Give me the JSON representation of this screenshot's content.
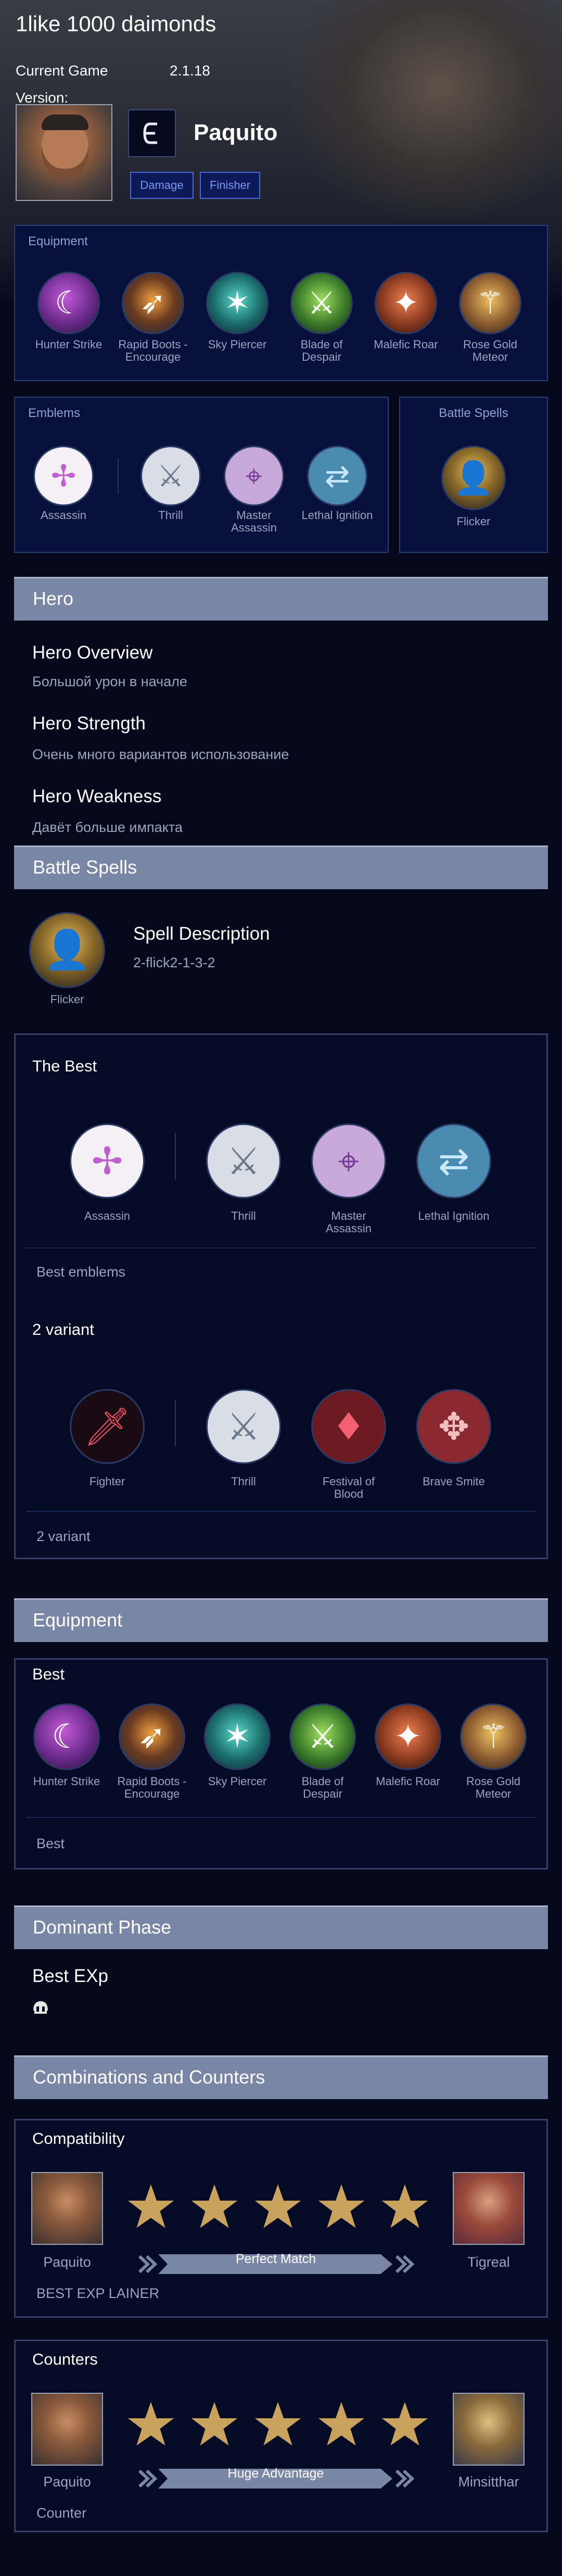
{
  "header": {
    "title": "1like 1000 daimonds",
    "current_game_label": "Current Game",
    "version_label": "Version:",
    "version_value": "2.1.18"
  },
  "hero": {
    "name": "Paquito",
    "roles": [
      "Damage",
      "Finisher"
    ],
    "class_icon": "e-shaped-class-icon"
  },
  "top_equipment": {
    "title": "Equipment",
    "items": [
      "Hunter Strike",
      "Rapid Boots - Encourage",
      "Sky Piercer",
      "Blade of Despair",
      "Malefic Roar",
      "Rose Gold Meteor"
    ]
  },
  "top_emblems": {
    "title": "Emblems",
    "items": [
      "Assassin",
      "Thrill",
      "Master Assassin",
      "Lethal Ignition"
    ]
  },
  "top_spells": {
    "title": "Battle Spells",
    "items": [
      "Flicker"
    ]
  },
  "hero_section": {
    "title": "Hero",
    "overview_title": "Hero Overview",
    "overview_text": "Большой урон в начале",
    "strength_title": "Hero Strength",
    "strength_text": "Очень много вариантов использование",
    "weakness_title": "Hero Weakness",
    "weakness_text": "Давёт больше импакта"
  },
  "battle_spells": {
    "title": "Battle Spells",
    "spell": "Flicker",
    "desc_title": "Spell Description",
    "desc_text": "2-flick2-1-3-2"
  },
  "emblem_sets": {
    "set1_title": "The Best",
    "set1_items": [
      "Assassin",
      "Thrill",
      "Master Assassin",
      "Lethal Ignition"
    ],
    "set1_note": "Best emblems",
    "set2_title": "2 variant",
    "set2_items": [
      "Fighter",
      "Thrill",
      "Festival of Blood",
      "Brave Smite"
    ],
    "set2_note": "2 variant"
  },
  "equipment": {
    "title": "Equipment",
    "build_title": "Best",
    "items": [
      "Hunter Strike",
      "Rapid Boots - Encourage",
      "Sky Piercer",
      "Blade of Despair",
      "Malefic Roar",
      "Rose Gold Meteor"
    ],
    "note": "Best"
  },
  "dominant_phase": {
    "title": "Dominant Phase",
    "lane": "Best EXp",
    "icon": "helmet-icon"
  },
  "combos": {
    "title": "Combinations and Counters",
    "compat_title": "Compatibility",
    "compat_left": "Paquito",
    "compat_right": "Tigreal",
    "compat_label": "Perfect Match",
    "compat_stars": 5,
    "compat_note": "BEST EXP LAINER",
    "counters_title": "Counters",
    "counter_left": "Paquito",
    "counter_right": "Minsitthar",
    "counter_label": "Huge Advantage",
    "counter_stars": 5,
    "counter_note": "Counter"
  },
  "colors": {
    "accent": "#7986a5",
    "panel": "#07103a",
    "star": "#c9a25e"
  }
}
